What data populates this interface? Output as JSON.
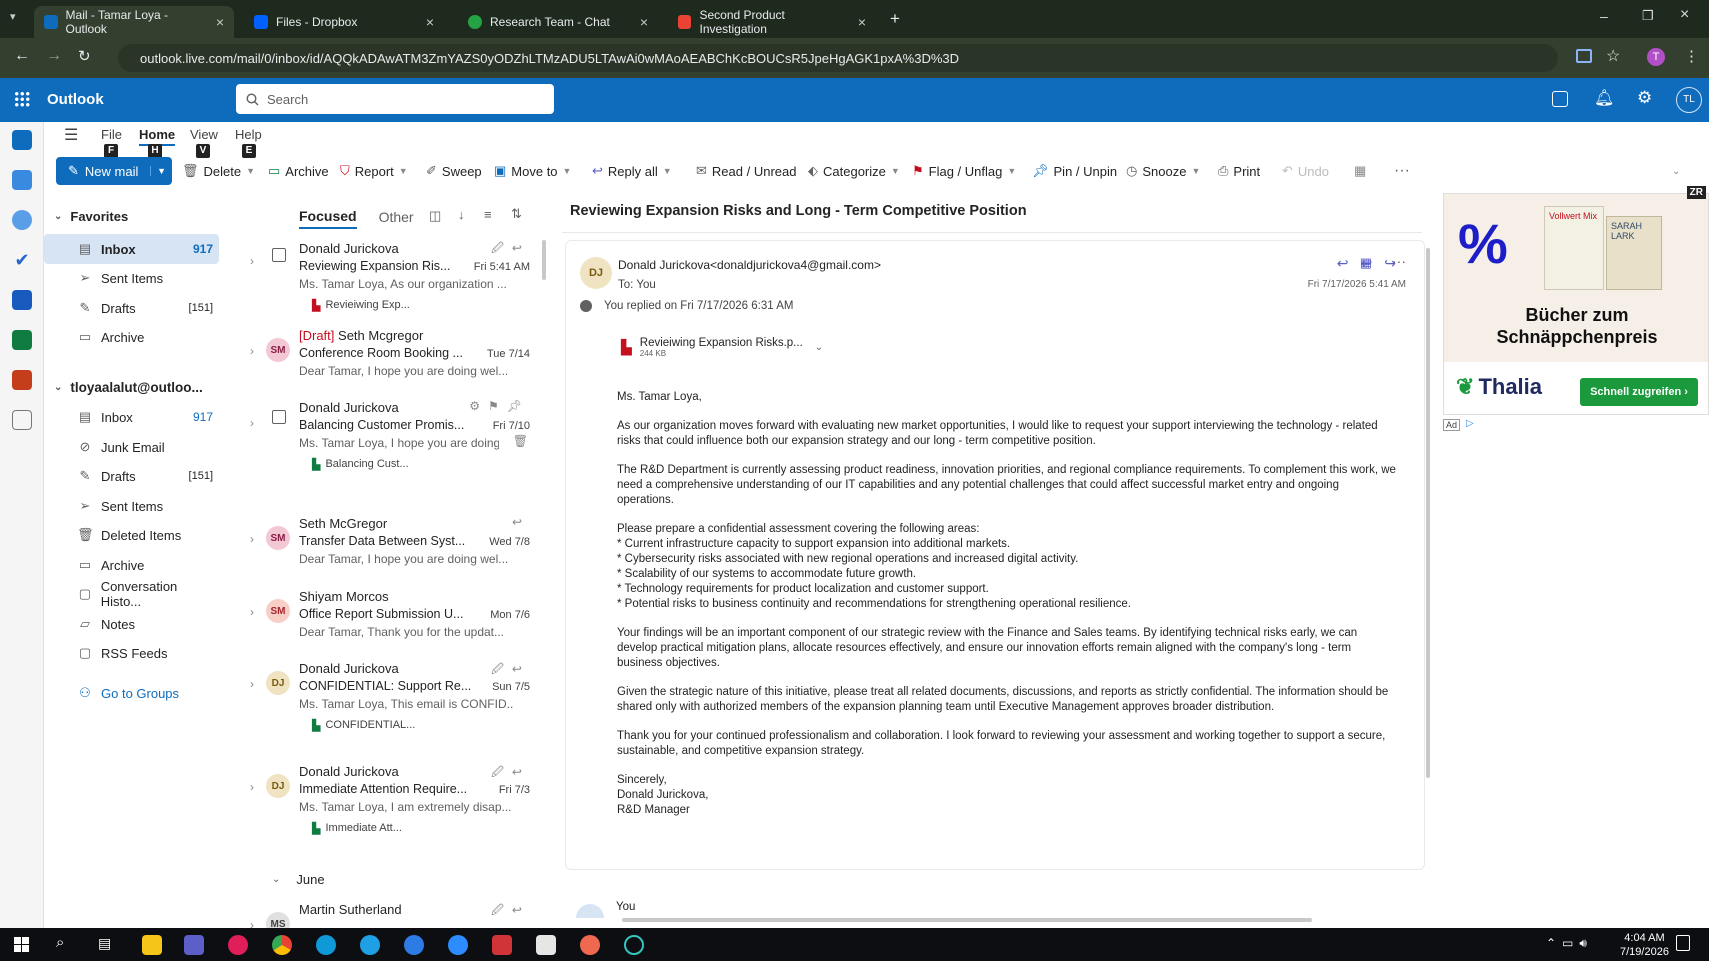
{
  "browser": {
    "tabs": [
      {
        "title": "Mail - Tamar Loya - Outlook",
        "color": "#0f6cbd"
      },
      {
        "title": "Files - Dropbox",
        "color": "#0061ff"
      },
      {
        "title": "Research Team - Chat",
        "color": "#25a244"
      },
      {
        "title": "Second Product Investigation",
        "color": "#ea4335"
      }
    ],
    "new_tab": "+",
    "url": "outlook.live.com/mail/0/inbox/id/AQQkADAwATM3ZmYAZS0yODZhLTMzADU5LTAwAi0wMAoAEABChKcBOUCsR5JpeHgAGK1pxA%3D%3D",
    "profile_initial": "T"
  },
  "outlook": {
    "app_name": "Outlook",
    "search_placeholder": "Search",
    "user_initials": "TL"
  },
  "ribbon": {
    "menu": [
      {
        "label": "File",
        "keytip": ""
      },
      {
        "label": "Home",
        "keytip": "H"
      },
      {
        "label": "View",
        "keytip": "V"
      },
      {
        "label": "Help",
        "keytip": "E"
      }
    ],
    "file_keytip": "F",
    "new_mail": "New mail",
    "delete": "Delete",
    "archive": "Archive",
    "report": "Report",
    "sweep": "Sweep",
    "move_to": "Move to",
    "reply_all": "Reply all",
    "read_unread": "Read / Unread",
    "categorize": "Categorize",
    "flag": "Flag / Unflag",
    "pin": "Pin / Unpin",
    "snooze": "Snooze",
    "print": "Print",
    "undo": "Undo"
  },
  "folders": {
    "favorites_label": "Favorites",
    "favorites": [
      {
        "name": "Inbox",
        "count": "917",
        "icon": "inbox-icon"
      },
      {
        "name": "Sent Items",
        "count": "",
        "icon": "send-icon"
      },
      {
        "name": "Drafts",
        "count": "[151]",
        "icon": "drafts-icon"
      },
      {
        "name": "Archive",
        "count": "",
        "icon": "archive-icon"
      }
    ],
    "account_label": "tloyaalalut@outloo...",
    "account_folders": [
      {
        "name": "Inbox",
        "count": "917"
      },
      {
        "name": "Junk Email",
        "count": ""
      },
      {
        "name": "Drafts",
        "count": "[151]"
      },
      {
        "name": "Sent Items",
        "count": ""
      },
      {
        "name": "Deleted Items",
        "count": ""
      },
      {
        "name": "Archive",
        "count": ""
      },
      {
        "name": "Conversation Histo...",
        "count": ""
      },
      {
        "name": "Notes",
        "count": ""
      },
      {
        "name": "RSS Feeds",
        "count": ""
      }
    ],
    "go_to_groups": "Go to Groups"
  },
  "message_list": {
    "tab_focused": "Focused",
    "tab_other": "Other",
    "messages": [
      {
        "sender": "Donald Jurickova",
        "draft": "",
        "subject": "Reviewing Expansion Ris...",
        "date": "Fri 5:41 AM",
        "preview": "Ms. Tamar Loya, As our organization ...",
        "attachment": "Revieiwing Exp...",
        "avatar": "",
        "avatar_color": ""
      },
      {
        "sender": "Seth Mcgregor",
        "draft": "[Draft]",
        "subject": "Conference Room Booking ...",
        "date": "Tue 7/14",
        "preview": "Dear Tamar, I hope you are doing wel...",
        "attachment": "",
        "avatar": "SM",
        "avatar_color": "#f4c7d4"
      },
      {
        "sender": "Donald Jurickova",
        "draft": "",
        "subject": "Balancing Customer Promis...",
        "date": "Fri 7/10",
        "preview": "Ms. Tamar Loya, I hope you are doing...",
        "attachment": "Balancing Cust...",
        "avatar": "",
        "avatar_color": ""
      },
      {
        "sender": "Seth McGregor",
        "draft": "",
        "subject": "Transfer Data Between Syst...",
        "date": "Wed 7/8",
        "preview": "Dear Tamar, I hope you are doing wel...",
        "attachment": "",
        "avatar": "SM",
        "avatar_color": "#f4c7d4"
      },
      {
        "sender": "Shiyam Morcos",
        "draft": "",
        "subject": "Office Report Submission U...",
        "date": "Mon 7/6",
        "preview": "Dear Tamar, Thank you for the updat...",
        "attachment": "",
        "avatar": "SM",
        "avatar_color": "#f8cfc6"
      },
      {
        "sender": "Donald Jurickova",
        "draft": "",
        "subject": "CONFIDENTIAL: Support Re...",
        "date": "Sun 7/5",
        "preview": "Ms. Tamar Loya, This email is CONFID...",
        "attachment": "CONFIDENTIAL...",
        "avatar": "DJ",
        "avatar_color": "#efe3c2"
      },
      {
        "sender": "Donald Jurickova",
        "draft": "",
        "subject": "Immediate Attention Require...",
        "date": "Fri 7/3",
        "preview": "Ms. Tamar Loya, I am extremely disap...",
        "attachment": "Immediate Att...",
        "avatar": "DJ",
        "avatar_color": "#efe3c2"
      }
    ],
    "group_june": "June",
    "last_sender": "Martin Sutherland",
    "last_avatar": "MS"
  },
  "reading": {
    "title": "Reviewing Expansion Risks and Long - Term Competitive Position",
    "from": "Donald Jurickova<donaldjurickova4@gmail.com>",
    "to": "To:",
    "to_value": "You",
    "sent_date": "Fri 7/17/2026 5:41 AM",
    "avatar": "DJ",
    "replied_note": "You replied on Fri 7/17/2026 6:31 AM",
    "attachment_name": "Revieiwing Expansion Risks.p...",
    "attachment_size": "244 KB",
    "greeting": "Ms. Tamar Loya,",
    "p1": "As our organization moves forward with evaluating new market opportunities, I would like to request your support interviewing the technology - related risks that could influence both our expansion strategy and our long - term competitive position.",
    "p2": "The R&D Department is currently assessing product readiness, innovation priorities, and regional compliance requirements. To complement this work, we need a comprehensive understanding of our IT capabilities and any potential challenges that could affect successful market entry and ongoing operations.",
    "list_intro": "Please prepare a confidential assessment covering the following areas:",
    "items": [
      "* Current infrastructure capacity to support expansion into additional markets.",
      "* Cybersecurity risks associated with new regional operations and increased digital activity.",
      "* Scalability of our systems to accommodate future growth.",
      "* Technology requirements for product localization and customer support.",
      "* Potential risks to business continuity and recommendations for strengthening operational resilience."
    ],
    "p3": "Your findings will be an important component of our strategic review with the Finance and Sales teams. By identifying technical risks early, we can develop practical mitigation plans, allocate resources effectively, and ensure our innovation efforts remain aligned with the company's long - term business objectives.",
    "p4": "Given the strategic nature of this initiative, please treat all related documents, discussions, and reports as strictly confidential. The information should be shared only with authorized members of the expansion planning team until Executive Management approves broader distribution.",
    "p5": "Thank you for your continued professionalism and collaboration. I look forward to reviewing your assessment and working together to support a secure, sustainable, and competitive expansion strategy.",
    "closing": "Sincerely,",
    "signature_name": "Donald Jurickova,",
    "signature_title": "R&D Manager",
    "next_from": "You"
  },
  "ad": {
    "headline": "Bücher zum Schnäppchenpreis",
    "brand": "Thalia",
    "cta": "Schnell zugreifen ›",
    "badge": "ZR",
    "ad_label": "Ad",
    "book1_title": "Vollwert Mix",
    "book2_title": "SARAH LARK",
    "accent": "#1a9a3c"
  },
  "taskbar": {
    "time": "4:04 AM",
    "date": "7/19/2026"
  }
}
